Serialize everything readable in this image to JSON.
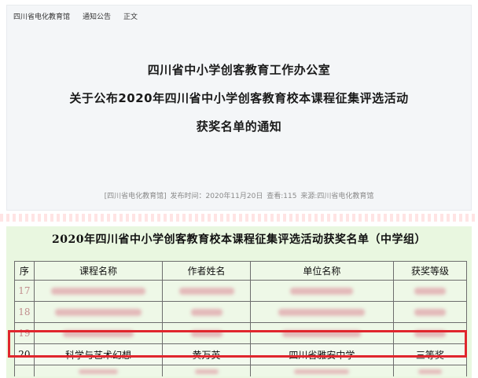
{
  "breadcrumb": {
    "items": [
      "四川省电化教育馆",
      "通知公告",
      "正文"
    ]
  },
  "article": {
    "title_lines": [
      "四川省中小学创客教育工作办公室",
      "关于公布2020年四川省中小学创客教育校本课程征集评选活动",
      "获奖名单的通知"
    ],
    "meta": {
      "source_tag": "[四川省电化教育馆]",
      "publish_time": "发布时间：2020年11月20日",
      "views": "查看:115",
      "origin": "来源:四川省电化教育馆"
    }
  },
  "award_doc": {
    "title": "2020年四川省中小学创客教育校本课程征集评选活动获奖名单（中学组）",
    "headers": [
      "序",
      "课程名称",
      "作者姓名",
      "单位名称",
      "获奖等级"
    ],
    "visible_row": {
      "no": "20",
      "course": "科学与艺术幻想",
      "author": "黄万英",
      "unit": "四川省雅安中学",
      "grade": "三等奖"
    },
    "blurred_rows": [
      {
        "no": "17"
      },
      {
        "no": "18"
      },
      {
        "no": "19"
      }
    ]
  },
  "colors": {
    "highlight_border": "#e0262d",
    "doc_background": "#e9f7e0",
    "article_background": "#f4f6f8"
  }
}
